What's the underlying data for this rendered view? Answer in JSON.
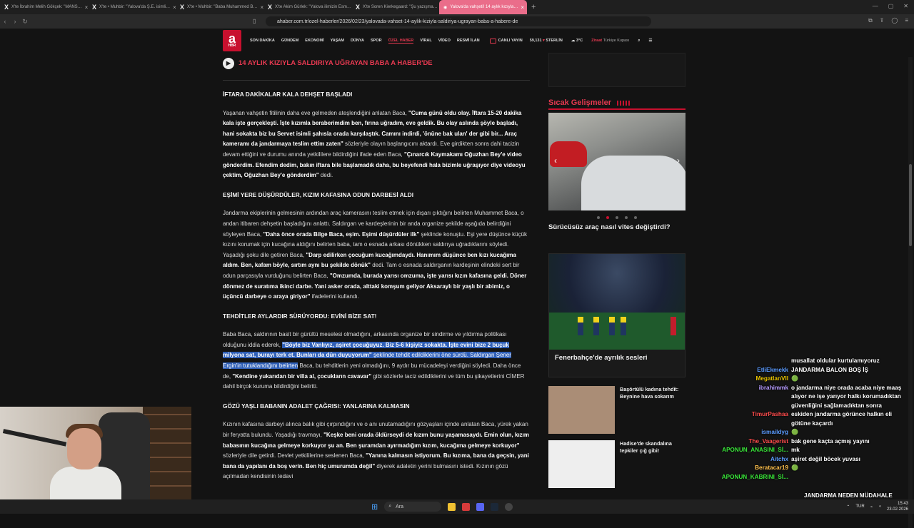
{
  "browser": {
    "tabs": [
      {
        "label": "X'te İbrahim Melih Gökçek: \"MANS…",
        "active": false
      },
      {
        "label": "X'te • Muhbir: \"Yalova'da Ş.E. isimli…",
        "active": false
      },
      {
        "label": "X'te • Muhbir: \"Baba Muhammed B…",
        "active": false
      },
      {
        "label": "X'te Akim Gürlek: \"Yalova ilimizin Esm…",
        "active": false
      },
      {
        "label": "X'te Soren Kierkegaard: \"Şu yazışma…",
        "active": false
      },
      {
        "label": "Yalova'da vahşeti! 14 aylık kızıyla…",
        "active": true
      }
    ],
    "url": "ahaber.com.tr/ozel-haberler/2026/02/23/yalovada-vahset-14-aylik-kiziyla-saldiriya-ugrayan-baba-a-habere-de"
  },
  "header": {
    "logo_letter": "a",
    "logo_sub": "HBR",
    "nav": [
      "SON DAKİKA",
      "GÜNDEM",
      "EKONOMİ",
      "YAŞAM",
      "DÜNYA",
      "SPOR",
      "ÖZEL HABER",
      "VİRAL",
      "VİDEO",
      "RESMİ İLAN"
    ],
    "live": "CANLI YAYIN",
    "currency_value": "59,131",
    "currency_label": "STERLİN",
    "weather": "3°C",
    "sponsor_1": "Ziraat",
    "sponsor_2": "Türkiye Kupası"
  },
  "article": {
    "video_link": "14 AYLIK KIZIYLA SALDIRIYA UĞRAYAN BABA A HABER'DE",
    "h1": "İFTARA DAKİKALAR KALA DEHŞET BAŞLADI",
    "p1a": "Yaşanan vahşetin fitilinin daha eve gelmeden ateşlendiğini anlatan Baca, ",
    "p1b": "\"Cuma günü oldu olay. İftara 15-20 dakika kala işte gerçekleşti. İşte kızımla beraberimdim ben, fırına uğradım, eve geldik. Bu olay aslında şöyle başladı, hani sokakta biz bu Servet isimli şahısla orada karşılaştık. Camını indirdi, 'önüne bak ulan' der gibi bir... Araç kameramı da jandarmaya teslim ettim zaten\"",
    "p1c": " sözleriyle olayın başlangıcını aktardı. Eve girdikten sonra dahi tacizin devam ettiğini ve durumu anında yetkililere bildirdiğini ifade eden Baca, ",
    "p1d": "\"Çınarcık Kaymakamı Oğuzhan Bey'e video gönderdim. Efendim dedim, bakın iftara bile başlamadık daha, bu beyefendi hala bizimle uğraşıyor diye videoyu çektim, Oğuzhan Bey'e gönderdim\"",
    "p1e": " dedi.",
    "h2": "EŞİMİ YERE DÜŞÜRDÜLER, KIZIM KAFASINA ODUN DARBESİ ALDI",
    "p2a": "Jandarma ekiplerinin gelmesinin ardından araç kamerasını teslim etmek için dışarı çıktığını belirten Muhammet Baca, o andan itibaren dehşetin başladığını anlattı. Saldırgan ve kardeşlerinin bir anda organize şekilde aşağıda belirdiğini söyleyen Baca, ",
    "p2b": "\"Daha önce orada Bilge Baca, eşim. Eşimi düşürdüler ilk\"",
    "p2c": " şeklinde konuştu. Eşi yere düşünce küçük kızını korumak için kucağına aldığını belirten baba, tam o esnada arkası dönükken saldırıya uğradıklarını söyledi. Yaşadığı şoku dile getiren Baca, ",
    "p2d": "\"Darp edilirken çocuğum kucağımdaydı. Hanımım düşünce ben kızı kucağıma aldım. Ben, kafam böyle, sırtım aynı bu şekilde dönük\"",
    "p2e": " dedi. Tam o esnada saldırganın kardeşinin elindeki sert bir odun parçasıyla vurduğunu belirten Baca, ",
    "p2f": "\"Omzumda, burada yarısı omzuma, işte yarısı kızın kafasına geldi. Döner dönmez de suratıma ikinci darbe. Yani asker orada, alttaki komşum geliyor Aksaraylı bir yaşlı bir abimiz, o üçüncü darbeye o araya giriyor\"",
    "p2g": " ifadelerini kullandı.",
    "h3": "TEHDİTLER AYLARDIR SÜRÜYORDU: EVİNİ BİZE SAT!",
    "p3a": "Baba Baca, saldırının basit bir gürültü meselesi olmadığını, arkasında organize bir sindirme ve yıldırma politikası olduğunu iddia ederek, ",
    "p3b": "\"Böyle biz Vanlıyız, aşiret çocuğuyuz. Biz 5-6 kişiyiz sokakta. İşte evini bize 2 buçuk milyona sat, burayı terk et. Bunları da dün duyuyorum\"",
    "p3c": " şeklinde tehdit edildiklerini öne sürdü. Saldırgan Şener Ergin'in tutuklandığını belirten",
    "p3d": " Baca, bu tehditlerin yeni olmadığını, 9 aydır bu mücadeleyi verdiğini söyledi. Daha önce de, ",
    "p3e": "\"Kendine yukarıdan bir villa al, çocukların cavavar\"",
    "p3f": " gibi sözlerle taciz edildiklerini ve tüm bu şikayetlerini CİMER dahil birçok kuruma bildirdiğini belirtti.",
    "h4": "GÖZÜ YAŞLI BABANIN ADALET ÇAĞRISI: YANLARINA KALMASIN",
    "p4a": "Kızının kafasına darbeyi alınca balık gibi çırpındığını ve o anı unutamadığını gözyaşları içinde anlatan Baca, yürek yakan bir feryatta bulundu. Yaşadığı travmayı, ",
    "p4b": "\"Keşke beni orada öldürseydi de kızım bunu yaşamasaydı. Emin olun, kızım babasının kucağına gelmeye korkuyor şu an. Ben şuramdan ayırmadığım kızım, kucağıma gelmeye korkuyor\"",
    "p4c": " sözleriyle dile getirdi. Devlet yetkililerine seslenen Baca, ",
    "p4d": "\"Yanına kalmasın istiyorum. Bu kızıma, bana da geçsin, yani bana da yapılanı da boş verin. Ben hiç umurumda değil\"",
    "p4e": " diyerek adaletin yerini bulmasını istedi. Kızının gözü açılmadan kendisinin tedavi"
  },
  "sidebar": {
    "section_title": "Sıcak Gelişmeler",
    "slider_caption": "Sürücüsüz araç nasıl vites değiştirdi?",
    "card_title": "Fenerbahçe'de ayrılık sesleri",
    "news": [
      {
        "title": "Başörtülü kadına tehdit: Beynine hava sokarım"
      },
      {
        "title": "Hadise'de skandalına tepkiler çığ gibi!"
      }
    ]
  },
  "chat": [
    {
      "name": "",
      "msg": "musallat oldular kurtulamıyoruz",
      "color": "#ffffff"
    },
    {
      "name": "EtliEkmekk",
      "msg": "JANDARMA BALON BOŞ İŞ",
      "color": "#5b9bff"
    },
    {
      "name": "MegatlanVII",
      "msg": "🟢",
      "color": "#e6c200"
    },
    {
      "name": "ibrahimmk",
      "msg": "o jandarma niye orada acaba niye maaş alıyor ne işe yarıyor halkı korumadıktan güvenliğini sağlamadıktan sonra",
      "color": "#b69bff"
    },
    {
      "name": "TimurPashaa",
      "msg": "eskiden jandarma görünce halkın eli götüne kaçardı",
      "color": "#ff4c4c"
    },
    {
      "name": "ismaildyg",
      "msg": "🟢",
      "color": "#5b9bff"
    },
    {
      "name": "The_Vaagerist",
      "msg": "bak gene kaçta açmış yayını",
      "color": "#ff4c4c"
    },
    {
      "name": "APONUN_ANASINI_Sİ...",
      "msg": "mk",
      "color": "#39e639"
    },
    {
      "name": "Aitchx",
      "msg": "aşiret değil böcek yuvası",
      "color": "#5b9bff"
    },
    {
      "name": "Beratacar19",
      "msg": "🟢",
      "color": "#ffc14c"
    },
    {
      "name": "APONUN_KABRINI_Sİ...",
      "msg": "",
      "color": "#39e639"
    }
  ],
  "overlay": {
    "bottom_text": "JANDARMA NEDEN MÜDAHALE ETMİYOR???"
  },
  "taskbar": {
    "search": "Ara",
    "lang": "TUR",
    "time": "15:43",
    "date": "23.02.2026"
  }
}
